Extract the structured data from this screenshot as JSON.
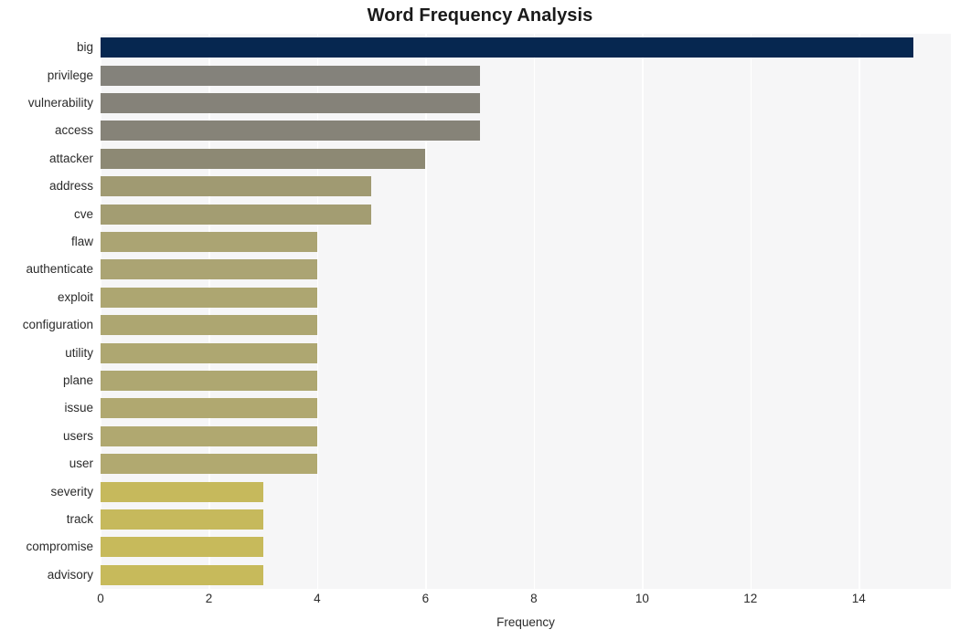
{
  "chart_data": {
    "type": "bar",
    "orientation": "horizontal",
    "title": "Word Frequency Analysis",
    "xlabel": "Frequency",
    "ylabel": "",
    "categories": [
      "big",
      "privilege",
      "vulnerability",
      "access",
      "attacker",
      "address",
      "cve",
      "flaw",
      "authenticate",
      "exploit",
      "configuration",
      "utility",
      "plane",
      "issue",
      "users",
      "user",
      "severity",
      "track",
      "compromise",
      "advisory"
    ],
    "values": [
      15,
      7,
      7,
      7,
      6,
      5,
      5,
      4,
      4,
      4,
      4,
      4,
      4,
      4,
      4,
      4,
      3,
      3,
      3,
      3
    ],
    "bar_colors": [
      "#062750",
      "#84827b",
      "#858279",
      "#868378",
      "#8d8974",
      "#a09a72",
      "#a39d72",
      "#aba473",
      "#aba473",
      "#ada671",
      "#ada671",
      "#aea771",
      "#aea771",
      "#b0a870",
      "#b0a870",
      "#b1a970",
      "#c6b95c",
      "#c6b95c",
      "#c7ba5b",
      "#c7ba5b"
    ],
    "xticks": [
      0,
      2,
      4,
      6,
      8,
      10,
      12,
      14
    ],
    "xtick_labels": [
      "0",
      "2",
      "4",
      "6",
      "8",
      "10",
      "12",
      "14"
    ],
    "xlim": [
      0,
      15.7
    ],
    "grid": "vertical-only",
    "legend": "none",
    "plot_background": "#f6f6f7",
    "gridline_color": "#ffffff",
    "title_color": "#1a1a1a",
    "tick_label_color": "#2b2b2b"
  }
}
